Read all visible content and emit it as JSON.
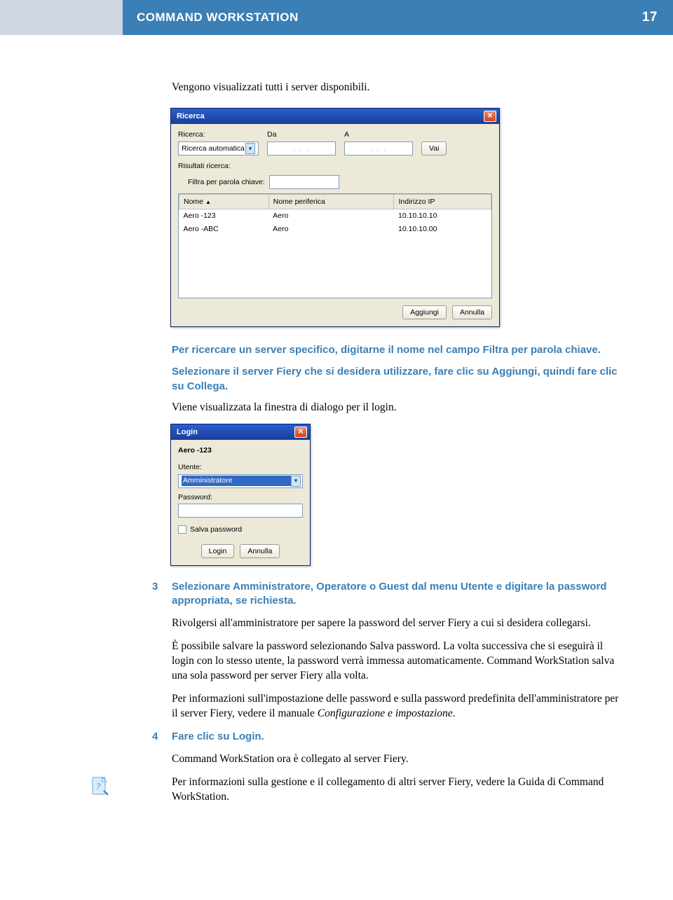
{
  "header": {
    "title": "COMMAND WORKSTATION",
    "page": "17"
  },
  "intro": "Vengono visualizzati tutti i server disponibili.",
  "ricerca": {
    "title": "Ricerca",
    "label_ricerca": "Ricerca:",
    "select_value": "Ricerca automatica",
    "label_da": "Da",
    "label_a": "A",
    "ip_dots": ".   .   .",
    "btn_vai": "Vai",
    "risultati": "Risultati ricerca:",
    "filtra_label": "Filtra per parola chiave:",
    "col_nome": "Nome",
    "col_periferica": "Nome periferica",
    "col_ip": "Indirizzo IP",
    "rows": [
      {
        "nome": "Aero -123",
        "periferica": "Aero",
        "ip": "10.10.10.10"
      },
      {
        "nome": "Aero -ABC",
        "periferica": "Aero",
        "ip": "10.10.10.00"
      }
    ],
    "btn_aggiungi": "Aggiungi",
    "btn_annulla": "Annulla"
  },
  "mid_instruct1": "Per ricercare un server specifico, digitarne il nome nel campo Filtra per parola chiave.",
  "mid_instruct2": "Selezionare il server Fiery che si desidera utilizzare, fare clic su Aggiungi, quindi fare clic su Collega.",
  "mid_text": "Viene visualizzata la finestra di dialogo per il login.",
  "login": {
    "title": "Login",
    "server": "Aero -123",
    "utente_label": "Utente:",
    "utente_value": "Amministratore",
    "password_label": "Password:",
    "salva": "Salva password",
    "btn_login": "Login",
    "btn_annulla": "Annulla"
  },
  "step3": {
    "num": "3",
    "head": "Selezionare Amministratore, Operatore o Guest dal menu Utente e digitare la password appropriata, se richiesta.",
    "p1": "Rivolgersi all'amministratore per sapere la password del server Fiery a cui si desidera collegarsi.",
    "p2": "È possibile salvare la password selezionando Salva password. La volta successiva che si eseguirà il login con lo stesso utente, la password verrà immessa automaticamente. Command WorkStation salva una sola password per server Fiery alla volta.",
    "p3a": "Per informazioni sull'impostazione delle password e sulla password predefinita dell'amministratore per il server Fiery, vedere il manuale ",
    "p3b": "Configurazione e impostazione",
    "p3c": "."
  },
  "step4": {
    "num": "4",
    "head": "Fare clic su Login.",
    "p1": "Command WorkStation ora è collegato al server Fiery.",
    "p2": "Per informazioni sulla gestione e il collegamento di altri server Fiery, vedere la Guida di Command WorkStation."
  }
}
